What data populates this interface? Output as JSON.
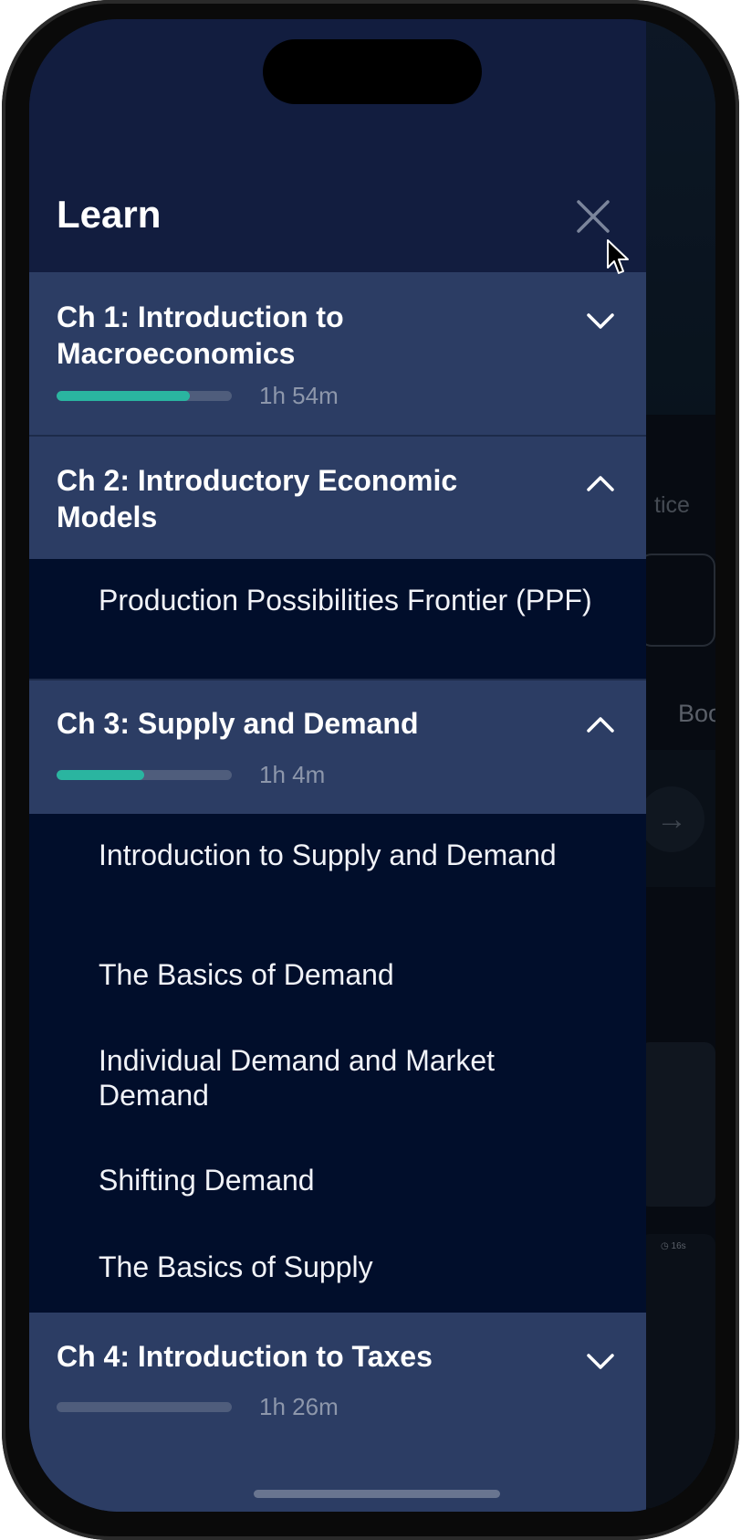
{
  "drawer": {
    "title": "Learn",
    "close_icon": "close-icon"
  },
  "background_page": {
    "practice_label_partial": "tice",
    "book_label_partial": "Boo",
    "arrow_icon": "arrow-right-icon",
    "mini_badge": "16s"
  },
  "chapters": [
    {
      "title": "Ch 1: Introduction to Macroeconomics",
      "duration": "1h 54m",
      "progress": 0.76,
      "expanded": false,
      "chevron_icon": "chevron-down-icon"
    },
    {
      "title": "Ch 2: Introductory Economic Models",
      "expanded": true,
      "chevron_icon": "chevron-up-icon",
      "lessons": [
        "Production Possibilities Frontier (PPF)"
      ]
    },
    {
      "title": "Ch 3: Supply and Demand",
      "duration": "1h 4m",
      "progress": 0.5,
      "expanded": true,
      "chevron_icon": "chevron-up-icon",
      "lessons": [
        "Introduction to Supply and Demand",
        "The Basics of Demand",
        "Individual Demand and Market Demand",
        "Shifting Demand",
        "The Basics of Supply"
      ]
    },
    {
      "title": "Ch 4: Introduction to Taxes",
      "duration": "1h 26m",
      "progress": 0.0,
      "expanded": false,
      "chevron_icon": "chevron-down-icon"
    }
  ],
  "colors": {
    "drawer_bg": "#121d3f",
    "chapter_bg": "#2c3d64",
    "lesson_bg": "#010e2b",
    "progress_fill": "#2ab5a0",
    "progress_track": "#4f5d7c"
  }
}
